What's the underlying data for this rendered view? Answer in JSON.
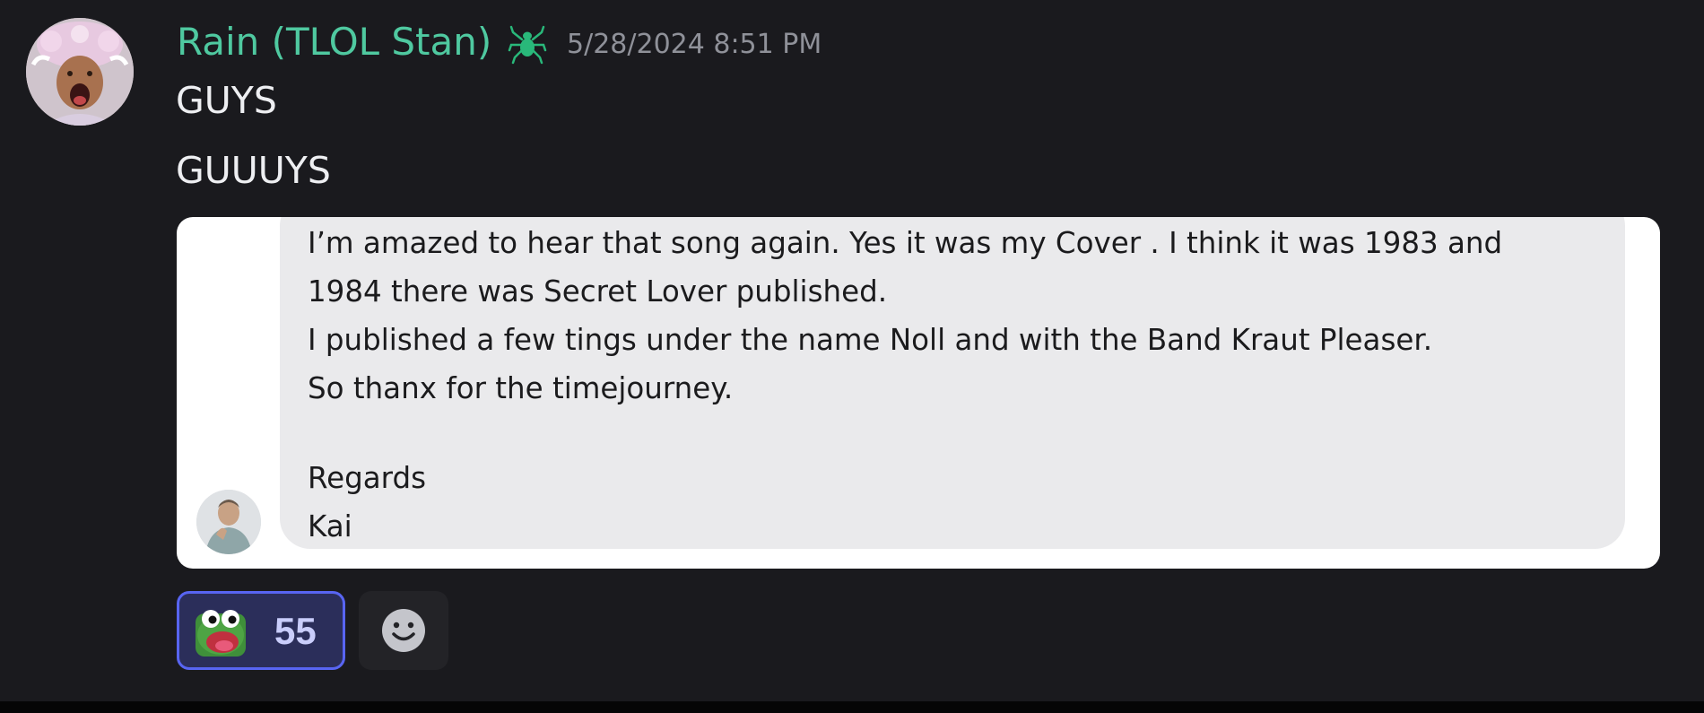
{
  "message": {
    "author": "Rain (TLOL Stan)",
    "author_color": "#4fc9a0",
    "role_icon": "spider-icon",
    "timestamp": "5/28/2024 8:51 PM",
    "lines": [
      "GUYS",
      "GUUUYS"
    ]
  },
  "embed": {
    "lines": [
      "I’m amazed to hear that song again. Yes it was my Cover . I think it was 1983 and",
      "1984 there was Secret Lover published.",
      "I published a few tings under the name Noll and with the Band Kraut Pleaser.",
      "So thanx for the timejourney.",
      "",
      "Regards",
      "Kai"
    ]
  },
  "reactions": [
    {
      "emoji": "pepe-frog-scream-emoji",
      "count": "55",
      "selected": true
    }
  ],
  "add_reaction_icon": "smiley-add-reaction-icon",
  "colors": {
    "background": "#1a1a1e",
    "reaction_border": "#5865f2",
    "reaction_bg": "#2b2e5a",
    "reaction_count": "#c9cdfb"
  }
}
